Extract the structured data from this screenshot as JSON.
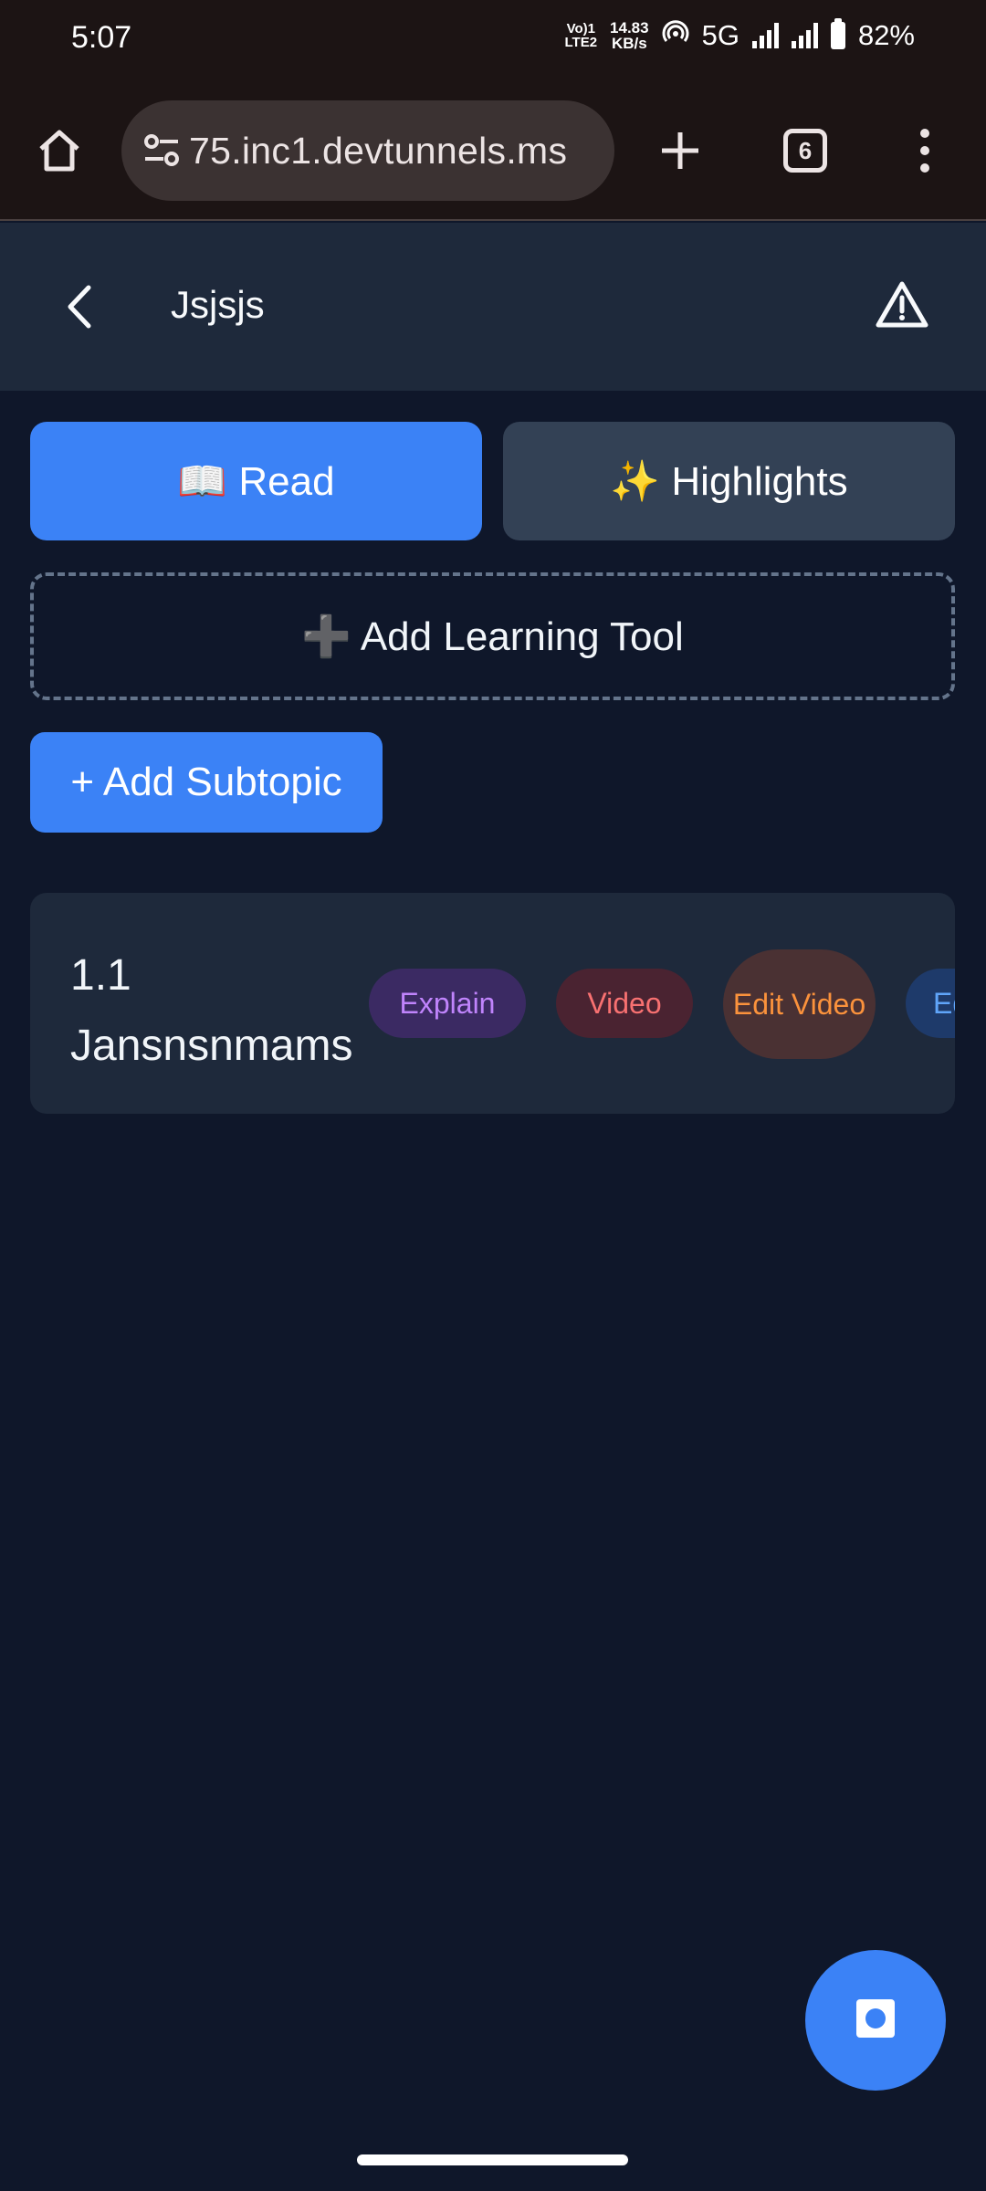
{
  "status_bar": {
    "time": "5:07",
    "net_label_top": "Vo)1",
    "net_label_bottom": "LTE2",
    "speed_value": "14.83",
    "speed_unit": "KB/s",
    "network_type": "5G",
    "battery": "82%",
    "icons": [
      "hotspot-icon",
      "signal-icon",
      "battery-icon"
    ]
  },
  "browser": {
    "url": "75.inc1.devtunnels.ms",
    "tab_count": "6",
    "icons": [
      "home-icon",
      "site-settings-icon",
      "new-tab-icon",
      "tab-switcher-icon",
      "more-menu-icon"
    ]
  },
  "header": {
    "title": "Jsjsjs",
    "icons": [
      "back-arrow-icon",
      "warning-icon"
    ]
  },
  "tabs": [
    {
      "label": "📖 Read",
      "active": true
    },
    {
      "label": "✨ Highlights",
      "active": false
    }
  ],
  "add_tool": {
    "label": "➕ Add Learning Tool"
  },
  "add_subtopic": {
    "label": "+ Add Subtopic"
  },
  "subtopic": {
    "number": "1.1",
    "name": "Jansnsnmams",
    "chips": {
      "explain": "Explain",
      "video": "Video",
      "edit_video": "Edit Video",
      "edit_partial": "Ed"
    }
  },
  "fab": {
    "icon": "record-icon"
  },
  "colors": {
    "primary": "#3b82f6",
    "background": "#0f172a",
    "card": "#1e293b",
    "explain": "#c084fc",
    "video": "#f87171",
    "edit_video": "#fb923c"
  }
}
